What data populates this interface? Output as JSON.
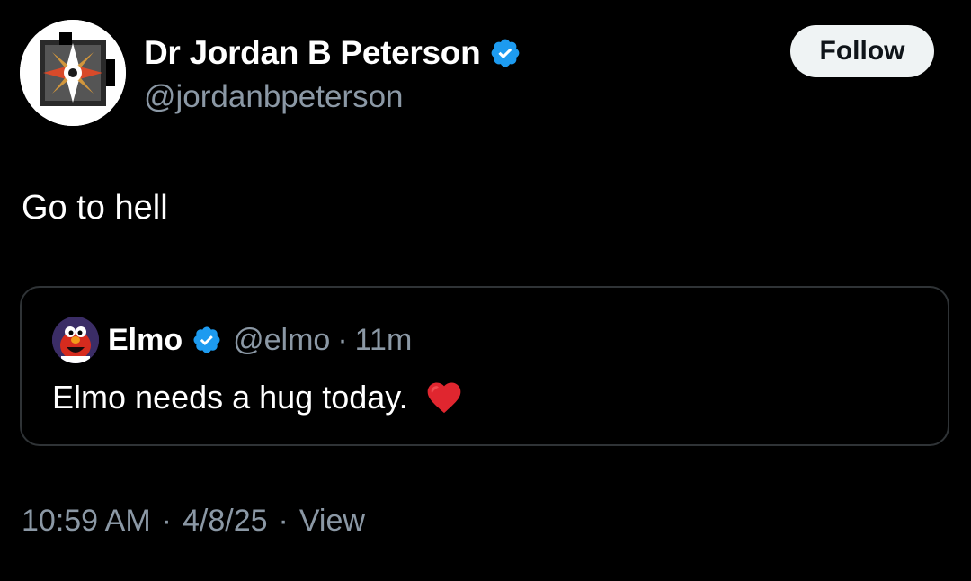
{
  "post": {
    "author": {
      "display_name": "Dr Jordan B Peterson",
      "handle": "@jordanbpeterson",
      "verified_icon": "verified-badge-icon",
      "avatar_icon": "profile-avatar"
    },
    "follow_label": "Follow",
    "text": "Go to hell",
    "quote": {
      "display_name": "Elmo",
      "handle": "@elmo",
      "separator": "·",
      "time_ago": "11m",
      "text": "Elmo needs a hug today.",
      "emoji_icon": "red-heart-icon"
    },
    "meta": {
      "time": "10:59 AM",
      "separator": "·",
      "date": "4/8/25",
      "views_label": "View"
    }
  },
  "colors": {
    "background": "#000000",
    "text_primary": "#ffffff",
    "text_secondary": "#8b98a5",
    "verified_blue": "#1d9bf0",
    "border": "#2f3336",
    "follow_bg": "#eff3f4",
    "heart": "#e0262f"
  }
}
